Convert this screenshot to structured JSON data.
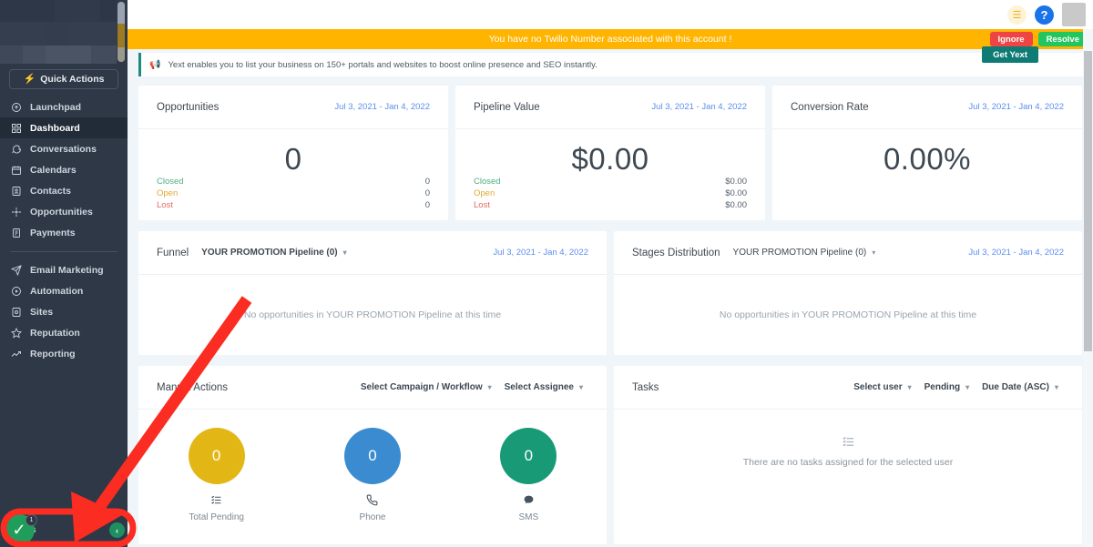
{
  "sidebar": {
    "quick_actions_label": "Quick Actions",
    "items": [
      {
        "label": "Launchpad",
        "icon": "rocket-icon",
        "active": false
      },
      {
        "label": "Dashboard",
        "icon": "grid-icon",
        "active": true
      },
      {
        "label": "Conversations",
        "icon": "chat-icon",
        "active": false
      },
      {
        "label": "Calendars",
        "icon": "calendar-icon",
        "active": false
      },
      {
        "label": "Contacts",
        "icon": "contacts-icon",
        "active": false
      },
      {
        "label": "Opportunities",
        "icon": "opportunities-icon",
        "active": false
      },
      {
        "label": "Payments",
        "icon": "payments-icon",
        "active": false
      }
    ],
    "items2": [
      {
        "label": "Email Marketing",
        "icon": "send-icon",
        "active": false
      },
      {
        "label": "Automation",
        "icon": "play-circle-icon",
        "active": false
      },
      {
        "label": "Sites",
        "icon": "sites-icon",
        "active": false
      },
      {
        "label": "Reputation",
        "icon": "star-icon",
        "active": false
      },
      {
        "label": "Reporting",
        "icon": "trending-up-icon",
        "active": false
      }
    ],
    "bottom_item": {
      "label": "Settings",
      "visible_text": "ttings",
      "icon": "gear-icon"
    },
    "badge_count": "1"
  },
  "topbar": {
    "list_icon": "list-icon",
    "help_icon": "help-icon",
    "avatar": "avatar"
  },
  "alert": {
    "message": "You have no Twilio Number associated with this account !",
    "ignore_label": "Ignore",
    "resolve_label": "Resolve",
    "bg_color": "#ffb400"
  },
  "yext": {
    "message": "Yext enables you to list your business on 150+ portals and websites to boost online presence and SEO instantly.",
    "button_label": "Get Yext",
    "accent_color": "#1c8a7e"
  },
  "date_range": "Jul 3, 2021 - Jan 4, 2022",
  "stats": [
    {
      "title": "Opportunities",
      "date": "Jul 3, 2021 - Jan 4, 2022",
      "value": "0",
      "legend": [
        {
          "label": "Closed",
          "value": "0"
        },
        {
          "label": "Open",
          "value": "0"
        },
        {
          "label": "Lost",
          "value": "0"
        }
      ]
    },
    {
      "title": "Pipeline Value",
      "date": "Jul 3, 2021 - Jan 4, 2022",
      "value": "$0.00",
      "legend": [
        {
          "label": "Closed",
          "value": "$0.00"
        },
        {
          "label": "Open",
          "value": "$0.00"
        },
        {
          "label": "Lost",
          "value": "$0.00"
        }
      ]
    },
    {
      "title": "Conversion Rate",
      "date": "Jul 3, 2021 - Jan 4, 2022",
      "value": "0.00%",
      "legend": []
    }
  ],
  "funnel": {
    "title": "Funnel",
    "pipeline_select": "YOUR PROMOTION Pipeline (0)",
    "date": "Jul 3, 2021 - Jan 4, 2022",
    "empty_text": "No opportunities in YOUR PROMOTION Pipeline at this time"
  },
  "stages": {
    "title": "Stages Distribution",
    "pipeline_select": "YOUR PROMOTION Pipeline (0)",
    "date": "Jul 3, 2021 - Jan 4, 2022",
    "empty_text": "No opportunities in YOUR PROMOTION Pipeline at this time"
  },
  "manual_actions": {
    "title": "Manual Actions",
    "campaign_select": "Select Campaign / Workflow",
    "assignee_select": "Select Assignee",
    "bubbles": [
      {
        "value": "0",
        "label": "Total Pending",
        "color": "#e2b715",
        "icon": "list-checks-icon"
      },
      {
        "value": "0",
        "label": "Phone",
        "color": "#3b8bd0",
        "icon": "phone-icon"
      },
      {
        "value": "0",
        "label": "SMS",
        "color": "#199a76",
        "icon": "sms-icon"
      }
    ]
  },
  "tasks": {
    "title": "Tasks",
    "user_select": "Select user",
    "status_select": "Pending",
    "sort_select": "Due Date (ASC)",
    "empty_text": "There are no tasks assigned for the selected user",
    "empty_icon": "task-list-icon"
  },
  "annotation": {
    "arrow_color": "#fb2c21",
    "highlight_color": "#fb2c21"
  }
}
